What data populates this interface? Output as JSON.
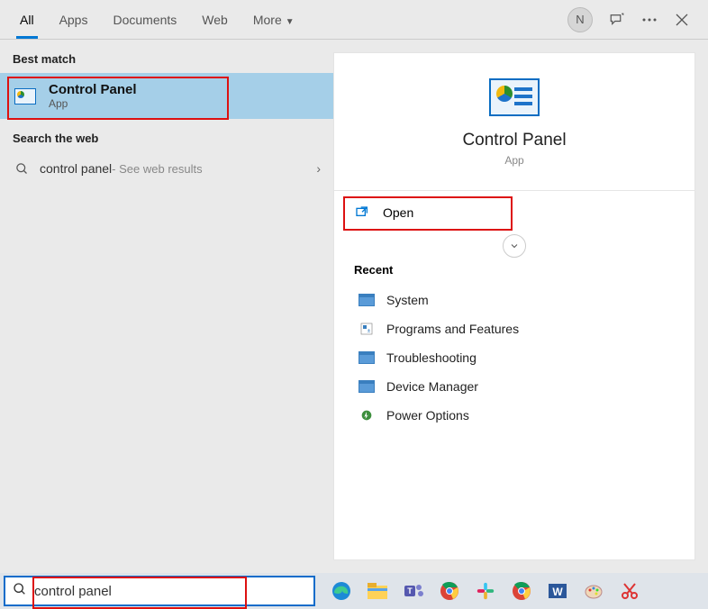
{
  "header": {
    "tabs": [
      "All",
      "Apps",
      "Documents",
      "Web",
      "More"
    ],
    "active_tab_index": 0,
    "avatar_letter": "N"
  },
  "left": {
    "best_match_label": "Best match",
    "best_match": {
      "title": "Control Panel",
      "subtitle": "App"
    },
    "search_web_label": "Search the web",
    "web_query": "control panel",
    "web_hint": " - See web results"
  },
  "right": {
    "title": "Control Panel",
    "subtitle": "App",
    "open_label": "Open",
    "recent_label": "Recent",
    "recent": [
      "System",
      "Programs and Features",
      "Troubleshooting",
      "Device Manager",
      "Power Options"
    ]
  },
  "taskbar": {
    "search_value": "control panel",
    "apps": [
      "edge",
      "file-explorer",
      "teams",
      "chrome",
      "slack",
      "chrome-canary",
      "word",
      "paint",
      "snip"
    ]
  },
  "highlights": {
    "best_match_box": true,
    "open_box": true,
    "search_box": true
  }
}
